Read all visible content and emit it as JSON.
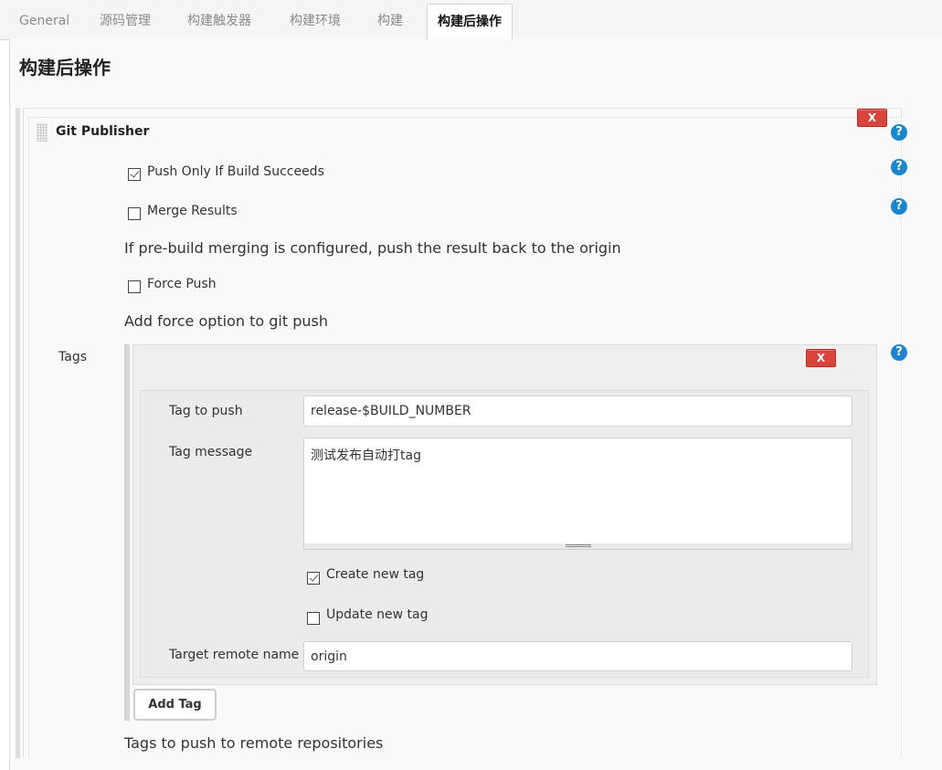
{
  "tabs": [
    {
      "label": "General"
    },
    {
      "label": "源码管理"
    },
    {
      "label": "构建触发器"
    },
    {
      "label": "构建环境"
    },
    {
      "label": "构建"
    },
    {
      "label": "构建后操作",
      "active": true
    }
  ],
  "section": {
    "title": "构建后操作"
  },
  "publisher": {
    "title": "Git Publisher",
    "delete_label": "X",
    "help_label": "?",
    "push_only_if_success": {
      "label": "Push Only If Build Succeeds",
      "checked": true
    },
    "merge_results": {
      "label": "Merge Results",
      "checked": false,
      "description": "If pre-build merging is configured, push the result back to the origin"
    },
    "force_push": {
      "label": "Force Push",
      "checked": false,
      "description": "Add force option to git push"
    },
    "tags": {
      "label": "Tags",
      "description": "Tags to push to remote repositories",
      "add_button": "Add Tag",
      "delete_label": "X",
      "items": [
        {
          "tag_to_push_label": "Tag to push",
          "tag_to_push_value": "release-$BUILD_NUMBER",
          "tag_message_label": "Tag message",
          "tag_message_value": "测试发布自动打tag",
          "create_new_tag": {
            "label": "Create new tag",
            "checked": true
          },
          "update_new_tag": {
            "label": "Update new tag",
            "checked": false
          },
          "target_remote_label": "Target remote name",
          "target_remote_value": "origin"
        }
      ]
    }
  },
  "colors": {
    "delete_red": "#d9453c",
    "help_blue": "#1a86d0",
    "panel_bg": "#efefef"
  }
}
